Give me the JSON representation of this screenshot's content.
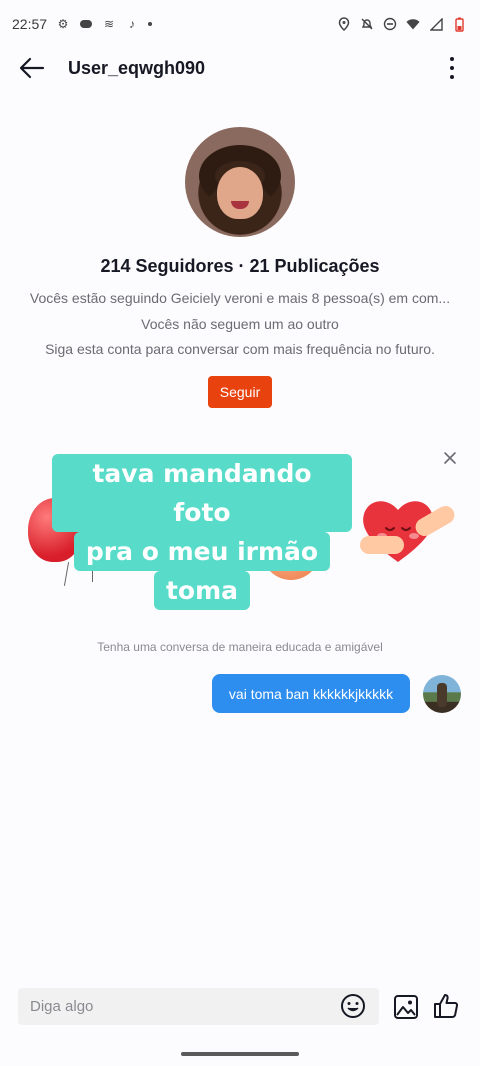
{
  "status_bar": {
    "time": "22:57"
  },
  "header": {
    "title": "User_eqwgh090"
  },
  "profile": {
    "stats": "214 Seguidores · 21 Publicações",
    "mutual": "Vocês estão seguindo Geiciely veroni e mais 8 pessoa(s) em com...",
    "not_following": "Vocês não seguem um ao outro",
    "hint": "Siga esta conta para conversar com mais frequência no futuro.",
    "follow_label": "Seguir"
  },
  "sticker": {
    "lines": [
      "tava mandando foto",
      "pra o meu irmão",
      "toma"
    ]
  },
  "chat": {
    "caption": "Tenha uma conversa de maneira educada e amigável",
    "messages": [
      {
        "text": "vai toma ban kkkkkkjkkkkk"
      }
    ]
  },
  "input": {
    "placeholder": "Diga algo"
  },
  "colors": {
    "accent": "#e8420f",
    "bubble": "#2d8ef0",
    "sticker_bg": "#58dcc9"
  }
}
